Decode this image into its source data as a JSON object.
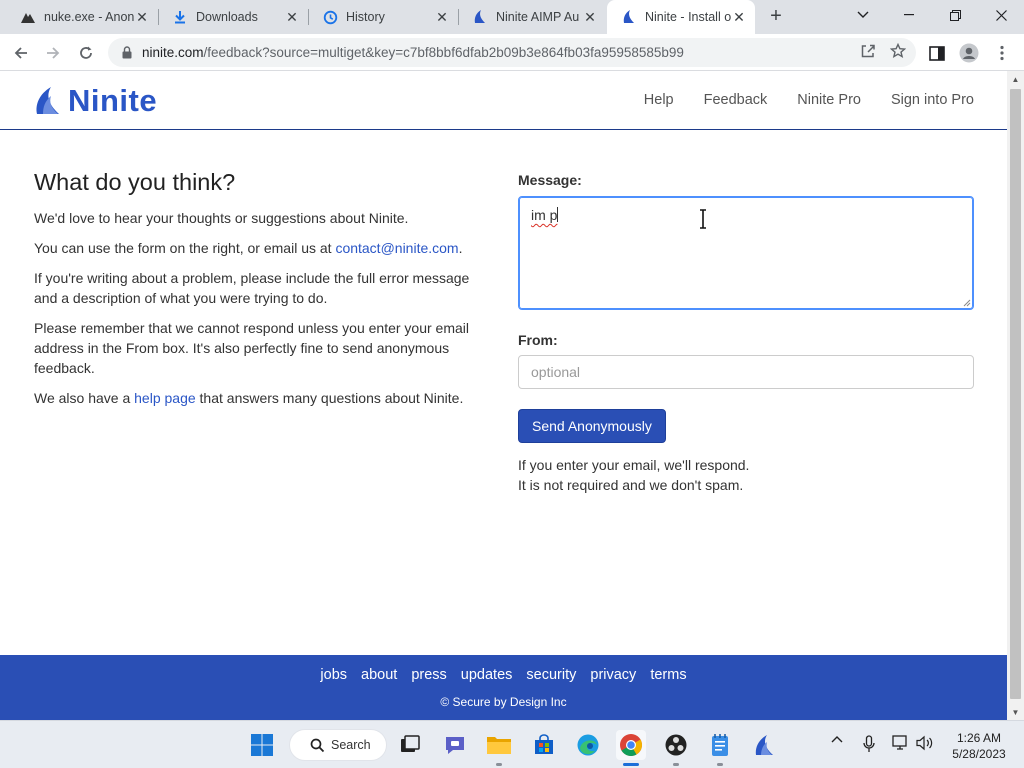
{
  "browser": {
    "tabs": [
      {
        "title": "nuke.exe - Anon",
        "icon": "nuke-site-icon",
        "active": false
      },
      {
        "title": "Downloads",
        "icon": "download-icon",
        "active": false
      },
      {
        "title": "History",
        "icon": "history-icon",
        "active": false
      },
      {
        "title": "Ninite AIMP Au",
        "icon": "ninite-icon",
        "active": false
      },
      {
        "title": "Ninite - Install o",
        "icon": "ninite-icon",
        "active": true
      }
    ],
    "url_host": "ninite.com",
    "url_path": "/feedback?source=multiget&key=c7bf8bbf6dfab2b09b3e864fb03fa95958585b99"
  },
  "site": {
    "logo_text": "Ninite",
    "nav": [
      "Help",
      "Feedback",
      "Ninite Pro",
      "Sign into Pro"
    ]
  },
  "content": {
    "heading": "What do you think?",
    "p1": "We'd love to hear your thoughts or suggestions about Ninite.",
    "p2_prefix": "You can use the form on the right, or email us at ",
    "p2_email": "contact@ninite.com",
    "p2_suffix": ".",
    "p3": "If you're writing about a problem, please include the full error message and a description of what you were trying to do.",
    "p4": "Please remember that we cannot respond unless you enter your email address in the From box. It's also perfectly fine to send anonymous feedback.",
    "p5_prefix": "We also have a ",
    "p5_link": "help page",
    "p5_suffix": " that answers many questions about Ninite."
  },
  "form": {
    "message_label": "Message:",
    "message_value": "im p",
    "from_label": "From:",
    "from_placeholder": "optional",
    "from_value": "",
    "send_button": "Send Anonymously",
    "note_line1": "If you enter your email, we'll respond.",
    "note_line2": "It is not required and we don't spam."
  },
  "footer": {
    "links": [
      "jobs",
      "about",
      "press",
      "updates",
      "security",
      "privacy",
      "terms"
    ],
    "copyright": "© Secure by Design Inc"
  },
  "taskbar": {
    "search_label": "Search",
    "time": "1:26 AM",
    "date": "5/28/2023"
  },
  "colors": {
    "brand_blue": "#2a4fb5",
    "link_blue": "#2a56c6",
    "focus_blue": "#4d90fe"
  }
}
